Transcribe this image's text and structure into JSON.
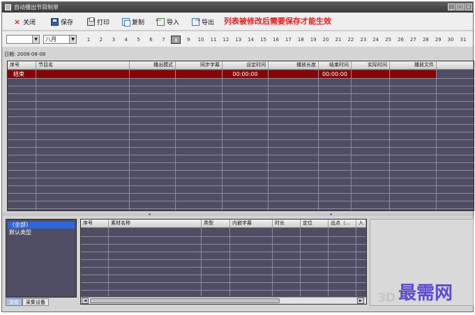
{
  "window": {
    "title": "自动播出节目制单",
    "min_label": "_",
    "max_label": "□",
    "close_label": "×"
  },
  "toolbar": {
    "close_label": "关闭",
    "save_label": "保存",
    "print_label": "打印",
    "copy_label": "复制",
    "import_label": "导入",
    "export_label": "导出",
    "close_icon": "×",
    "warning": "列表被修改后需要保存才能生效"
  },
  "date_selector": {
    "year_value": "",
    "month_value": "八月",
    "dropdown_arrow": "▼",
    "days": [
      "1",
      "2",
      "3",
      "4",
      "5",
      "6",
      "7",
      "8",
      "9",
      "10",
      "11",
      "12",
      "13",
      "14",
      "15",
      "16",
      "17",
      "18",
      "19",
      "20",
      "21",
      "22",
      "23",
      "24",
      "25",
      "26",
      "27",
      "28",
      "29",
      "30",
      "31"
    ],
    "selected_day": "8"
  },
  "schedule": {
    "date_label": "日期: 2008-08-08",
    "columns": [
      "序号",
      "节目名",
      "播出模式",
      "同步字幕",
      "设定时间",
      "播放长度",
      "结束时间",
      "实际时间",
      "播放文件"
    ],
    "rows": [
      {
        "index": "结束",
        "name": "",
        "mode": "",
        "subtitle": "",
        "set_time": "00:00:00",
        "length": "",
        "end_time": "00:00:00",
        "actual_time": "",
        "file": ""
      }
    ]
  },
  "categories": {
    "items": [
      "（全部）",
      "默认类型"
    ],
    "tabs": [
      "文件",
      "采集设备"
    ]
  },
  "materials": {
    "columns": [
      "序号",
      "素材名称",
      "类型",
      "内嵌字幕",
      "时长",
      "定位",
      "出点（...",
      "入"
    ]
  },
  "scroll": {
    "left_arrow": "◄",
    "right_arrow": "►"
  },
  "watermark": {
    "logo": "3D",
    "text": "最需网"
  },
  "colors": {
    "grid_bg": "#4f4d63",
    "end_row": "#8a0303",
    "warning_text": "#e41c1c",
    "selection": "#2f68d6"
  }
}
